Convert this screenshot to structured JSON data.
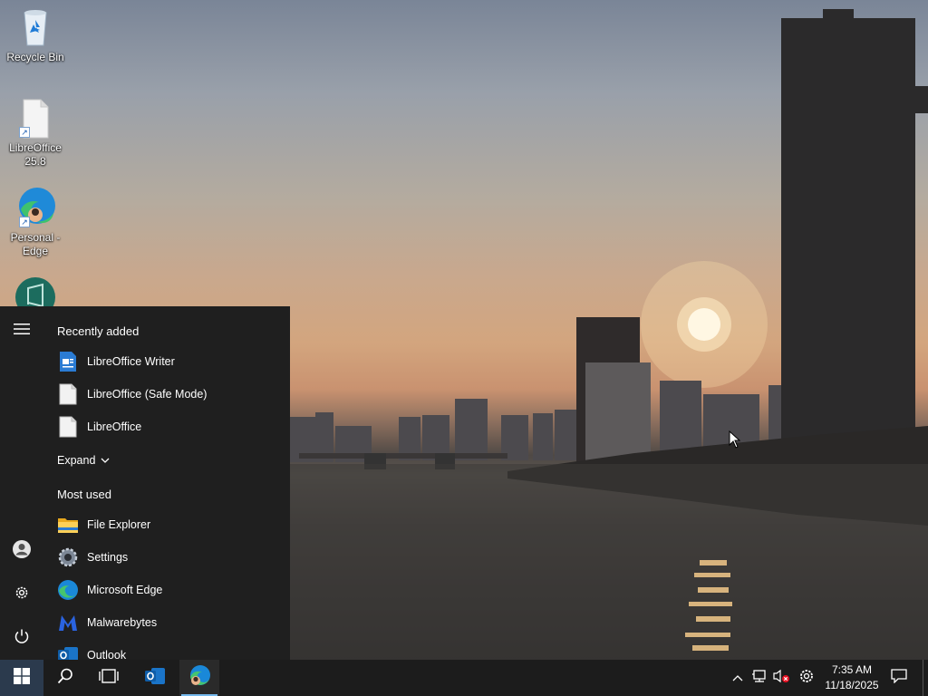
{
  "desktop": {
    "icons": [
      {
        "label": "Recycle Bin",
        "icon": "recycle-bin-icon"
      },
      {
        "label": "LibreOffice 25.8",
        "icon": "libreoffice-file-icon"
      },
      {
        "label": "Personal - Edge",
        "icon": "edge-profile-icon"
      },
      {
        "label": "",
        "icon": "teal-app-icon"
      }
    ]
  },
  "start_menu": {
    "recently_added_heading": "Recently added",
    "recent_apps": [
      {
        "label": "LibreOffice Writer",
        "icon": "libreoffice-writer-icon"
      },
      {
        "label": "LibreOffice (Safe Mode)",
        "icon": "libreoffice-doc-icon"
      },
      {
        "label": "LibreOffice",
        "icon": "libreoffice-doc-icon"
      }
    ],
    "expand_label": "Expand",
    "most_used_heading": "Most used",
    "most_used_apps": [
      {
        "label": "File Explorer",
        "icon": "folder-icon"
      },
      {
        "label": "Settings",
        "icon": "settings-gear-icon"
      },
      {
        "label": "Microsoft Edge",
        "icon": "edge-icon"
      },
      {
        "label": "Malwarebytes",
        "icon": "malwarebytes-icon"
      },
      {
        "label": "Outlook",
        "icon": "outlook-icon"
      }
    ],
    "rail": [
      "hamburger-menu-icon",
      "user-account-icon",
      "settings-icon",
      "power-icon"
    ]
  },
  "taskbar": {
    "pinned": [
      "windows-start-icon",
      "search-icon",
      "task-view-icon",
      "outlook-icon",
      "edge-profile-icon"
    ],
    "tray": [
      "chevron-up-icon",
      "network-icon",
      "volume-muted-icon",
      "settings-gear-icon",
      "notification-icon"
    ],
    "clock_time": "7:35 AM",
    "clock_date": "11/18/2025"
  },
  "colors": {
    "start_menu_bg": "#1f1f1f",
    "taskbar_bg": "#1c1c1c",
    "accent": "#76b9ed"
  }
}
